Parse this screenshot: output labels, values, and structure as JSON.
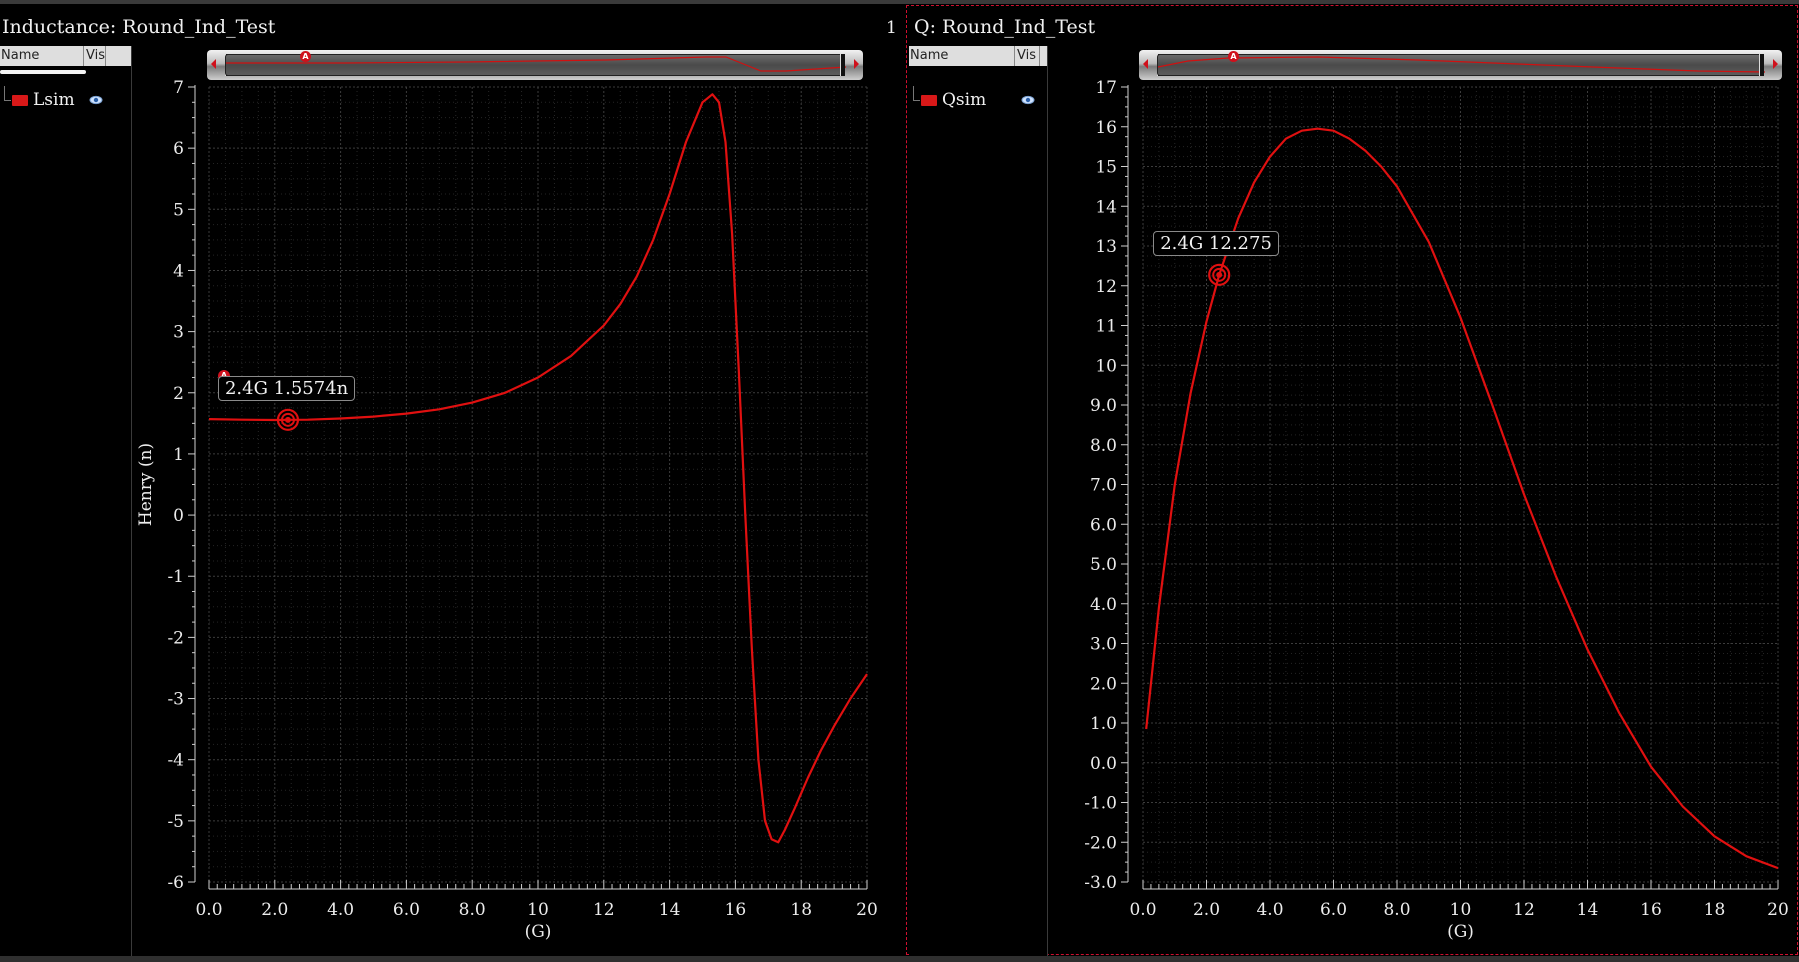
{
  "theme": {
    "trace_color": "#e01010",
    "background": "#000000",
    "grid_color": "#3a3a3a",
    "accent_dash": "#d01030"
  },
  "legend_header": {
    "name": "Name",
    "vis": "Vis"
  },
  "panels": [
    {
      "title": "Inductance: Round_Ind_Test",
      "index": "1",
      "trace_name": "Lsim",
      "marker": {
        "letter": "A",
        "label": "2.4G 1.5574n",
        "x": 2.4,
        "y": 1.5574
      },
      "ylabel": "Henry (n)",
      "xlabel": "(G)",
      "yticks": [
        "7",
        "6",
        "5",
        "4",
        "3",
        "2",
        "1",
        "0",
        "-1",
        "-2",
        "-3",
        "-4",
        "-5",
        "-6"
      ],
      "xticks": [
        "0.0",
        "2.0",
        "4.0",
        "6.0",
        "8.0",
        "10",
        "12",
        "14",
        "16",
        "18",
        "20"
      ]
    },
    {
      "title": "Q: Round_Ind_Test",
      "trace_name": "Qsim",
      "marker": {
        "letter": "A",
        "label": "2.4G 12.275",
        "x": 2.4,
        "y": 12.275
      },
      "ylabel": "",
      "xlabel": "(G)",
      "yticks": [
        "17",
        "16",
        "15",
        "14",
        "13",
        "12",
        "11",
        "10",
        "9.0",
        "8.0",
        "7.0",
        "6.0",
        "5.0",
        "4.0",
        "3.0",
        "2.0",
        "1.0",
        "0.0",
        "-1.0",
        "-2.0",
        "-3.0"
      ],
      "xticks": [
        "0.0",
        "2.0",
        "4.0",
        "6.0",
        "8.0",
        "10",
        "12",
        "14",
        "16",
        "18",
        "20"
      ]
    }
  ],
  "chart_data": [
    {
      "type": "line",
      "title": "Inductance: Round_Ind_Test",
      "xlabel": "(G)",
      "ylabel": "Henry (n)",
      "xlim": [
        0,
        20
      ],
      "ylim": [
        -6,
        7
      ],
      "grid": true,
      "series": [
        {
          "name": "Lsim",
          "color": "#e01010",
          "x": [
            0.0,
            1.0,
            2.0,
            2.4,
            3.0,
            4.0,
            5.0,
            6.0,
            7.0,
            8.0,
            9.0,
            10.0,
            11.0,
            12.0,
            12.5,
            13.0,
            13.5,
            14.0,
            14.5,
            15.0,
            15.3,
            15.5,
            15.7,
            15.9,
            16.1,
            16.3,
            16.5,
            16.7,
            16.9,
            17.1,
            17.3,
            17.5,
            17.8,
            18.2,
            18.6,
            19.0,
            19.5,
            20.0
          ],
          "y": [
            1.57,
            1.56,
            1.555,
            1.5574,
            1.56,
            1.58,
            1.61,
            1.66,
            1.73,
            1.84,
            2.0,
            2.25,
            2.6,
            3.1,
            3.45,
            3.9,
            4.5,
            5.25,
            6.1,
            6.75,
            6.88,
            6.75,
            6.1,
            4.6,
            2.4,
            0.0,
            -2.2,
            -4.0,
            -5.0,
            -5.3,
            -5.35,
            -5.15,
            -4.8,
            -4.3,
            -3.85,
            -3.45,
            -3.0,
            -2.6
          ]
        }
      ]
    },
    {
      "type": "line",
      "title": "Q: Round_Ind_Test",
      "xlabel": "(G)",
      "xlim": [
        0,
        20
      ],
      "ylim": [
        -3,
        17
      ],
      "grid": true,
      "series": [
        {
          "name": "Qsim",
          "color": "#e01010",
          "x": [
            0.1,
            0.5,
            1.0,
            1.5,
            2.0,
            2.4,
            3.0,
            3.5,
            4.0,
            4.5,
            5.0,
            5.5,
            6.0,
            6.5,
            7.0,
            7.5,
            8.0,
            9.0,
            10.0,
            11.0,
            12.0,
            13.0,
            14.0,
            15.0,
            16.0,
            17.0,
            18.0,
            19.0,
            20.0
          ],
          "y": [
            0.85,
            3.9,
            7.0,
            9.3,
            11.1,
            12.275,
            13.7,
            14.6,
            15.25,
            15.7,
            15.9,
            15.95,
            15.9,
            15.7,
            15.4,
            15.0,
            14.5,
            13.1,
            11.2,
            9.0,
            6.75,
            4.7,
            2.85,
            1.25,
            -0.1,
            -1.1,
            -1.85,
            -2.35,
            -2.65
          ]
        }
      ]
    }
  ]
}
